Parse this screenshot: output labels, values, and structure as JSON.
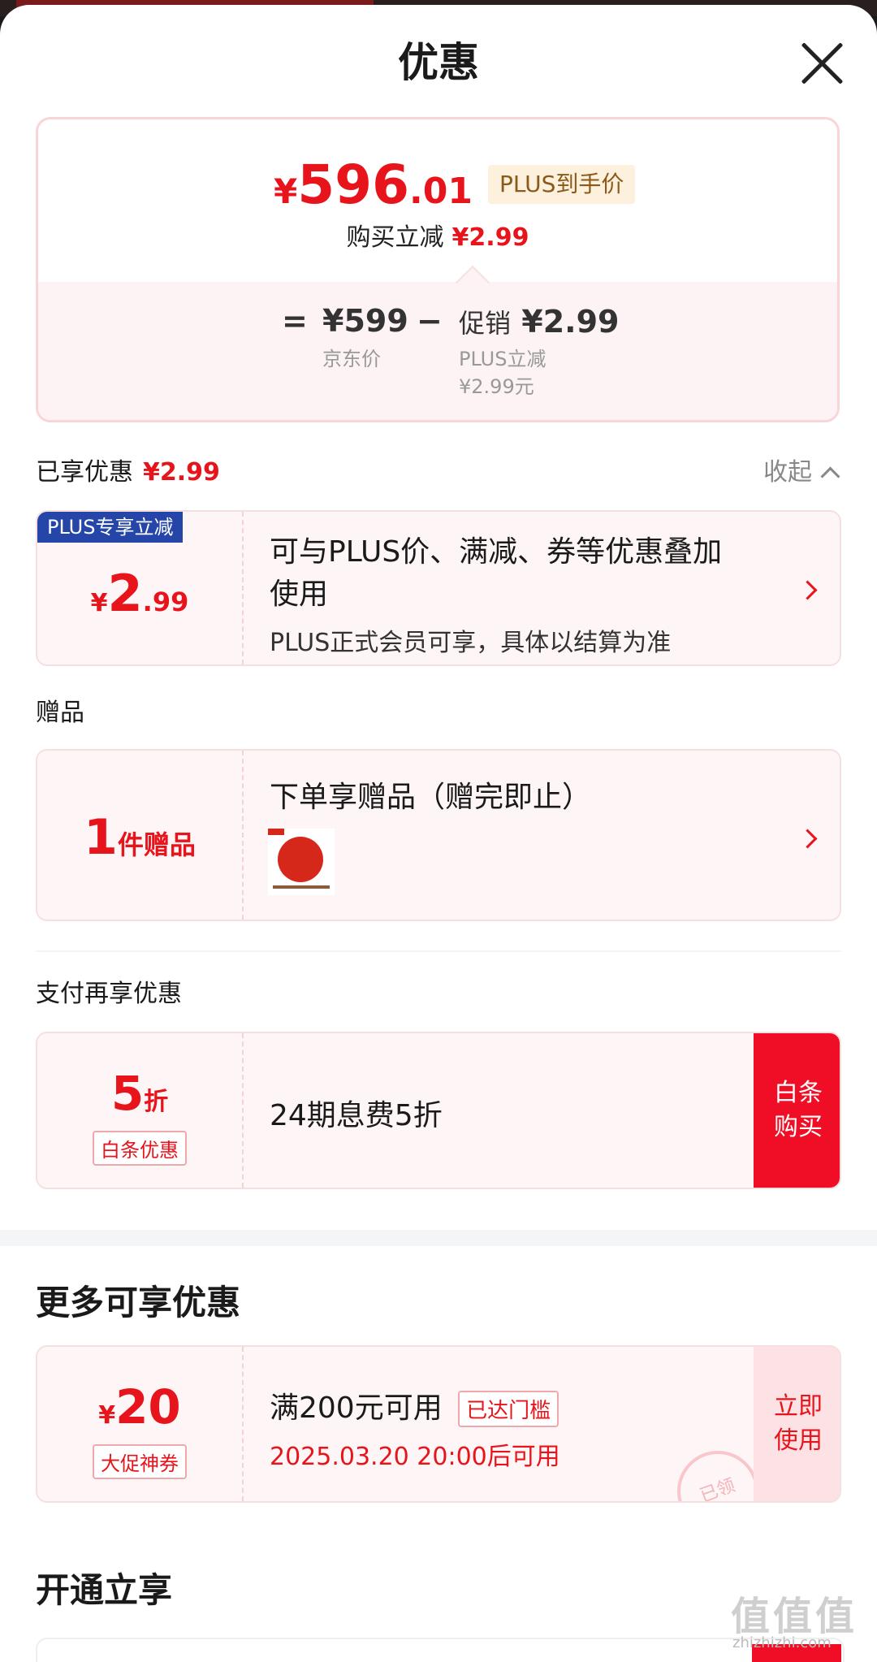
{
  "sheet": {
    "title": "优惠"
  },
  "price": {
    "yen": "¥",
    "integer": "596",
    "decimal": ".01",
    "plus_tag": "PLUS到手价",
    "reduce_label": "购买立减",
    "reduce_value": "¥2.99",
    "eq": "=",
    "jd_price": "¥599",
    "jd_label": "京东价",
    "minus": "−",
    "promo_label": "促销",
    "promo_value": "¥2.99",
    "promo_sub1": "PLUS立减",
    "promo_sub2": "¥2.99元"
  },
  "enjoyed": {
    "label": "已享优惠",
    "value": "¥2.99",
    "collapse": "收起",
    "card": {
      "ribbon": "PLUS专享立减",
      "yen": "¥",
      "int": "2",
      "dec": ".99",
      "line1": "可与PLUS价、满减、券等优惠叠加",
      "line2": "使用",
      "line3": "PLUS正式会员可享，具体以结算为准"
    }
  },
  "gift": {
    "label": "赠品",
    "count": "1",
    "unit": "件赠品",
    "title": "下单享赠品（赠完即止）"
  },
  "pay": {
    "label": "支付再享优惠",
    "discount": "5",
    "discount_unit": "折",
    "tag": "白条优惠",
    "text": "24期息费5折",
    "button": "白条购买"
  },
  "more": {
    "label": "更多可享优惠",
    "coupon": {
      "yen": "¥",
      "amount": "20",
      "tag": "大促神券",
      "cond": "满200元可用",
      "badge": "已达门槛",
      "time": "2025.03.20 20:00后可用",
      "button": "立即使用",
      "seal": "已领"
    }
  },
  "open": {
    "label": "开通立享"
  },
  "watermark": {
    "text": "值值值",
    "url": "zhizhizhi.com"
  },
  "colors": {
    "accent": "#e8141c",
    "plus_blue": "#2545a8",
    "card_bg": "#fdf5f6"
  }
}
